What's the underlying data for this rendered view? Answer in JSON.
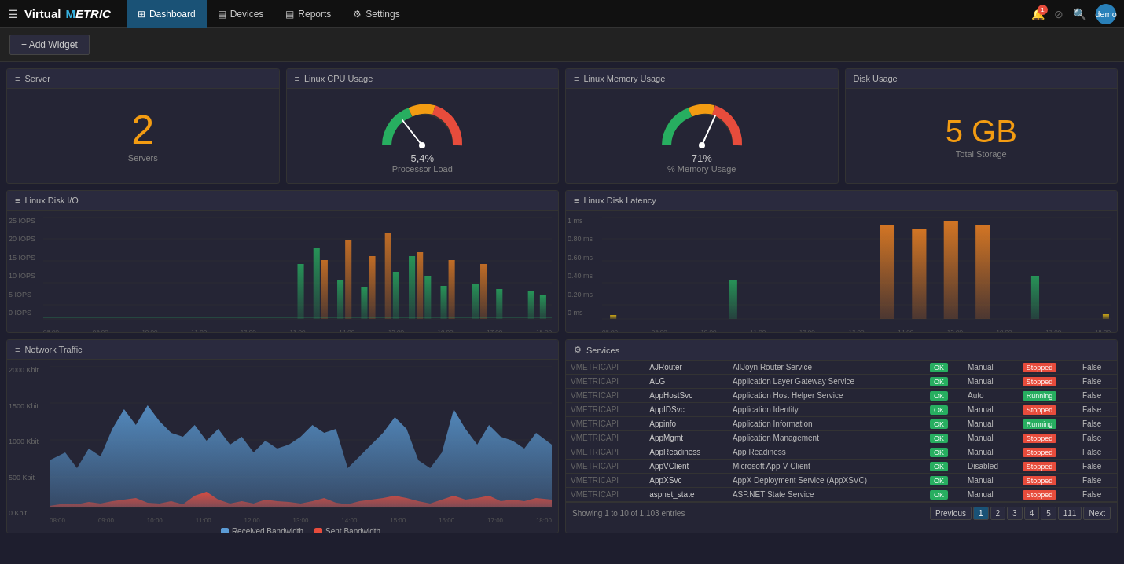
{
  "nav": {
    "brand": "VirtualMETRIC",
    "items": [
      {
        "label": "Dashboard",
        "icon": "⊞",
        "active": true
      },
      {
        "label": "Devices",
        "icon": "≡"
      },
      {
        "label": "Reports",
        "icon": "≡"
      },
      {
        "label": "Settings",
        "icon": "⚙"
      }
    ],
    "notif_count": "1",
    "user": "demo"
  },
  "add_widget": "+ Add Widget",
  "widgets": {
    "server": {
      "title": "Server",
      "icon": "≡",
      "value": "2",
      "label": "Servers"
    },
    "cpu": {
      "title": "Linux CPU Usage",
      "icon": "≡",
      "value": "5,4%",
      "label": "Processor Load"
    },
    "memory": {
      "title": "Linux Memory Usage",
      "icon": "≡",
      "value": "71%",
      "label": "% Memory Usage"
    },
    "disk_usage": {
      "title": "Disk Usage",
      "value": "5 GB",
      "label": "Total Storage"
    },
    "disk_io": {
      "title": "Linux Disk I/O",
      "icon": "≡",
      "y_labels": [
        "25 IOPS",
        "20 IOPS",
        "15 IOPS",
        "10 IOPS",
        "5 IOPS",
        "0 IOPS"
      ]
    },
    "disk_latency": {
      "title": "Linux Disk Latency",
      "icon": "≡",
      "y_labels": [
        "1 ms",
        "0.80 ms",
        "0.60 ms",
        "0.40 ms",
        "0.20 ms",
        "0 ms"
      ]
    },
    "network": {
      "title": "Network Traffic",
      "icon": "≡",
      "y_labels": [
        "2000 Kbit",
        "1500 Kbit",
        "1000 Kbit",
        "500 Kbit",
        "0 Kbit"
      ],
      "legend": [
        "Received Bandwidth",
        "Sent Bandwidth"
      ]
    },
    "services": {
      "title": "Services",
      "icon": "⚙",
      "columns": [
        "",
        "",
        "",
        "",
        "",
        "",
        ""
      ],
      "rows": [
        {
          "server": "VMETRICAPI",
          "name": "AJRouter",
          "description": "AllJoyn Router Service",
          "status": "OK",
          "startup": "Manual",
          "state": "Stopped",
          "trigger": "False"
        },
        {
          "server": "VMETRICAPI",
          "name": "ALG",
          "description": "Application Layer Gateway Service",
          "status": "OK",
          "startup": "Manual",
          "state": "Stopped",
          "trigger": "False"
        },
        {
          "server": "VMETRICAPI",
          "name": "AppHostSvc",
          "description": "Application Host Helper Service",
          "status": "OK",
          "startup": "Auto",
          "state": "Running",
          "trigger": "False"
        },
        {
          "server": "VMETRICAPI",
          "name": "AppIDSvc",
          "description": "Application Identity",
          "status": "OK",
          "startup": "Manual",
          "state": "Stopped",
          "trigger": "False"
        },
        {
          "server": "VMETRICAPI",
          "name": "Appinfo",
          "description": "Application Information",
          "status": "OK",
          "startup": "Manual",
          "state": "Running",
          "trigger": "False"
        },
        {
          "server": "VMETRICAPI",
          "name": "AppMgmt",
          "description": "Application Management",
          "status": "OK",
          "startup": "Manual",
          "state": "Stopped",
          "trigger": "False"
        },
        {
          "server": "VMETRICAPI",
          "name": "AppReadiness",
          "description": "App Readiness",
          "status": "OK",
          "startup": "Manual",
          "state": "Stopped",
          "trigger": "False"
        },
        {
          "server": "VMETRICAPI",
          "name": "AppVClient",
          "description": "Microsoft App-V Client",
          "status": "OK",
          "startup": "Disabled",
          "state": "Stopped",
          "trigger": "False"
        },
        {
          "server": "VMETRICAPI",
          "name": "AppXSvc",
          "description": "AppX Deployment Service (AppXSVC)",
          "status": "OK",
          "startup": "Manual",
          "state": "Stopped",
          "trigger": "False"
        },
        {
          "server": "VMETRICAPI",
          "name": "aspnet_state",
          "description": "ASP.NET State Service",
          "status": "OK",
          "startup": "Manual",
          "state": "Stopped",
          "trigger": "False"
        }
      ],
      "footer": "Showing 1 to 10 of 1,103 entries",
      "pagination": [
        "Previous",
        "1",
        "2",
        "3",
        "4",
        "5",
        "111",
        "Next"
      ]
    }
  }
}
